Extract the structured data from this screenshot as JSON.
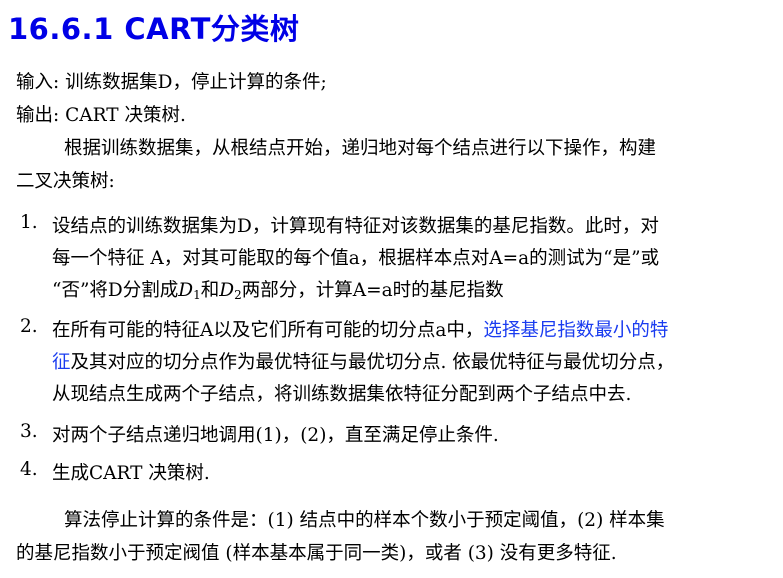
{
  "title": "16.6.1 CART分类树",
  "input_line": "输入: 训练数据集D，停止计算的条件;",
  "output_line": "输出: CART 决策树.",
  "intro_line1": "根据训练数据集，从根结点开始，递归地对每个结点进行以下操作，构建",
  "intro_line2": "二叉决策树:",
  "steps": [
    {
      "num": "1.",
      "line1": "设结点的训练数据集为D，计算现有特征对该数据集的基尼指数。此时，对",
      "line2": "每一个特征  A，对其可能取的每个值a，根据样本点对A=a的测试为“是”或",
      "line3_a": "“否”将D分割成",
      "d1": "D",
      "d1_sub": "1",
      "line3_b": "和",
      "d2": "D",
      "d2_sub": "2",
      "line3_c": "两部分，计算A=a时的基尼指数"
    },
    {
      "num": "2.",
      "line1_a": "在所有可能的特征A以及它们所有可能的切分点a中，",
      "line1_b": "选择基尼指数最小的特",
      "line2_a": "征",
      "line2_b": "及其对应的切分点作为最优特征与最优切分点. 依最优特征与最优切分点，",
      "line3": "从现结点生成两个子结点，将训练数据集依特征分配到两个子结点中去."
    },
    {
      "num": "3.",
      "line1": "对两个子结点递归地调用(1)，(2)，直至满足停止条件."
    },
    {
      "num": "4.",
      "line1": "生成CART 决策树."
    }
  ],
  "footer_line1": "算法停止计算的条件是：(1)  结点中的样本个数小于预定阈值，(2)  样本集",
  "footer_line2": "的基尼指数小于预定阀值 (样本基本属于同一类)，或者 (3) 没有更多特征.",
  "colors": {
    "title": "#0000e6",
    "highlight": "#1a3cf0"
  }
}
